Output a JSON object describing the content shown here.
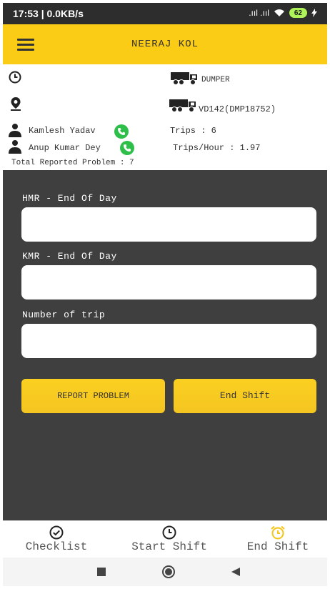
{
  "status": {
    "time_net": "17:53 | 0.0KB/s",
    "signal": ".ııl .ııl",
    "battery": "62"
  },
  "app_bar": {
    "title": "NEERAJ KOL"
  },
  "info": {
    "vehicle_type": "DUMPER",
    "vehicle_id": "VD142(DMP18752)",
    "person_1": "Kamlesh Yadav",
    "person_2": "Anup Kumar Dey",
    "trips": "Trips : 6",
    "trips_per_hour": "Trips/Hour : 1.97",
    "total_reported": "Total Reported Problem : 7"
  },
  "form": {
    "hmr_label": "HMR - End Of Day",
    "hmr_value": "",
    "kmr_label": "KMR - End Of Day",
    "kmr_value": "",
    "trips_label": "Number of trip",
    "trips_value": ""
  },
  "buttons": {
    "report": "REPORT PROBLEM",
    "end_shift": "End Shift"
  },
  "bottom_nav": {
    "checklist": "Checklist",
    "start_shift": "Start Shift",
    "end_shift": "End Shift",
    "active": "end_shift"
  },
  "colors": {
    "accent": "#fbcc15",
    "background": "#3f3f3f",
    "phone_green": "#2dbf4a",
    "active_icon": "#f5c518"
  },
  "icons": [
    "menu-icon",
    "clock-icon",
    "location-pin-icon",
    "dumper-truck-icon",
    "person-icon",
    "phone-icon",
    "check-circle-icon",
    "alarm-clock-icon",
    "square-icon",
    "circle-icon",
    "triangle-back-icon"
  ]
}
